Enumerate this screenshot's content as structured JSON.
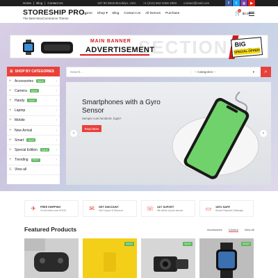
{
  "topbar": {
    "links": [
      "Home",
      "Blog",
      "Contact Us"
    ],
    "address": "187 90 West Brooklyn, USA",
    "phone": "+1 (212) 562-3466 2993",
    "email": "contact@mail.com"
  },
  "header": {
    "logo": "STORESHIP PRO.",
    "tagline": "The Best WooCommerce Theme",
    "nav": [
      "Home",
      "Shop",
      "Blog",
      "Contact Us",
      "All Demos",
      "Purchase"
    ],
    "cart_count": "0",
    "cart_total": "$0.00"
  },
  "socials": [
    {
      "name": "facebook-icon",
      "glyph": "f",
      "color": "#3b5998"
    },
    {
      "name": "twitter-icon",
      "glyph": "t",
      "color": "#1da1f2"
    },
    {
      "name": "instagram-icon",
      "glyph": "◎",
      "color": "#7a3fa8"
    },
    {
      "name": "youtube-icon",
      "glyph": "▶",
      "color": "#e62117"
    }
  ],
  "banner": {
    "main_banner": "MAIN BANNER",
    "advertisement": "ADVERTISEMENT",
    "section": "SECTION",
    "big_sale": "BIG SALE",
    "special_offer": "SPECIAL OFFER!"
  },
  "sidebar": {
    "heading": "SHOP BY CATEGORIES",
    "items": [
      {
        "label": "Accessories",
        "tag": "SALE!",
        "tag_color": "#5cb85c"
      },
      {
        "label": "Camera",
        "tag": "SALE!",
        "tag_color": "#5cb85c"
      },
      {
        "label": "Handy",
        "tag": "SALE!",
        "tag_color": "#5cb85c"
      },
      {
        "label": "Laptop",
        "tag": "",
        "tag_color": ""
      },
      {
        "label": "Mobile",
        "tag": "",
        "tag_color": ""
      },
      {
        "label": "New Arrival",
        "tag": "",
        "tag_color": ""
      },
      {
        "label": "Smart",
        "tag": "SALE!",
        "tag_color": "#5cb85c"
      },
      {
        "label": "Special Edition",
        "tag": "SALE!",
        "tag_color": "#5cb85c"
      },
      {
        "label": "Trending",
        "tag": "SALE!",
        "tag_color": "#5cb85c"
      },
      {
        "label": "View all",
        "tag": "",
        "tag_color": ""
      }
    ]
  },
  "search": {
    "placeholder": "Search...",
    "category": "-- Categories --"
  },
  "slider": {
    "title": "Smartphones with a Gyro Sensor",
    "subtitle": "Semper cum hendrerit, fugis?",
    "button": "Read More"
  },
  "features": [
    {
      "icon": "✈",
      "icon_name": "plane-icon",
      "title": "FREE SHIPPING",
      "text": "On all orders over $75.00"
    },
    {
      "icon": "✉",
      "icon_name": "gift-icon",
      "title": "GET DISCOUNT",
      "text": "Get Coupon & Discount"
    },
    {
      "icon": "☏",
      "icon_name": "headset-icon",
      "title": "24/7 SUPORT",
      "text": "We will be at your service"
    },
    {
      "icon": "▭",
      "icon_name": "card-icon",
      "title": "100% SAFE",
      "text": "Secure Payment Gateways"
    }
  ],
  "featured": {
    "title": "Featured Products",
    "tabs": [
      "Accessories",
      "Camera",
      "View all"
    ],
    "active_tab": 1
  },
  "products": [
    {
      "name": "product-gamepad",
      "sale": "",
      "bg": "#cfcfcf"
    },
    {
      "name": "product-yellow",
      "sale": "SALE!",
      "bg": "#f4cf1a"
    },
    {
      "name": "product-camera",
      "sale": "SALE!",
      "bg": "#d6d6d6"
    },
    {
      "name": "product-watch",
      "sale": "SALE!",
      "bg": "#bdbdbd"
    }
  ],
  "colors": {
    "accent": "#e8413a",
    "sale_green": "#5cb85c",
    "dark": "#1f1f1f"
  }
}
